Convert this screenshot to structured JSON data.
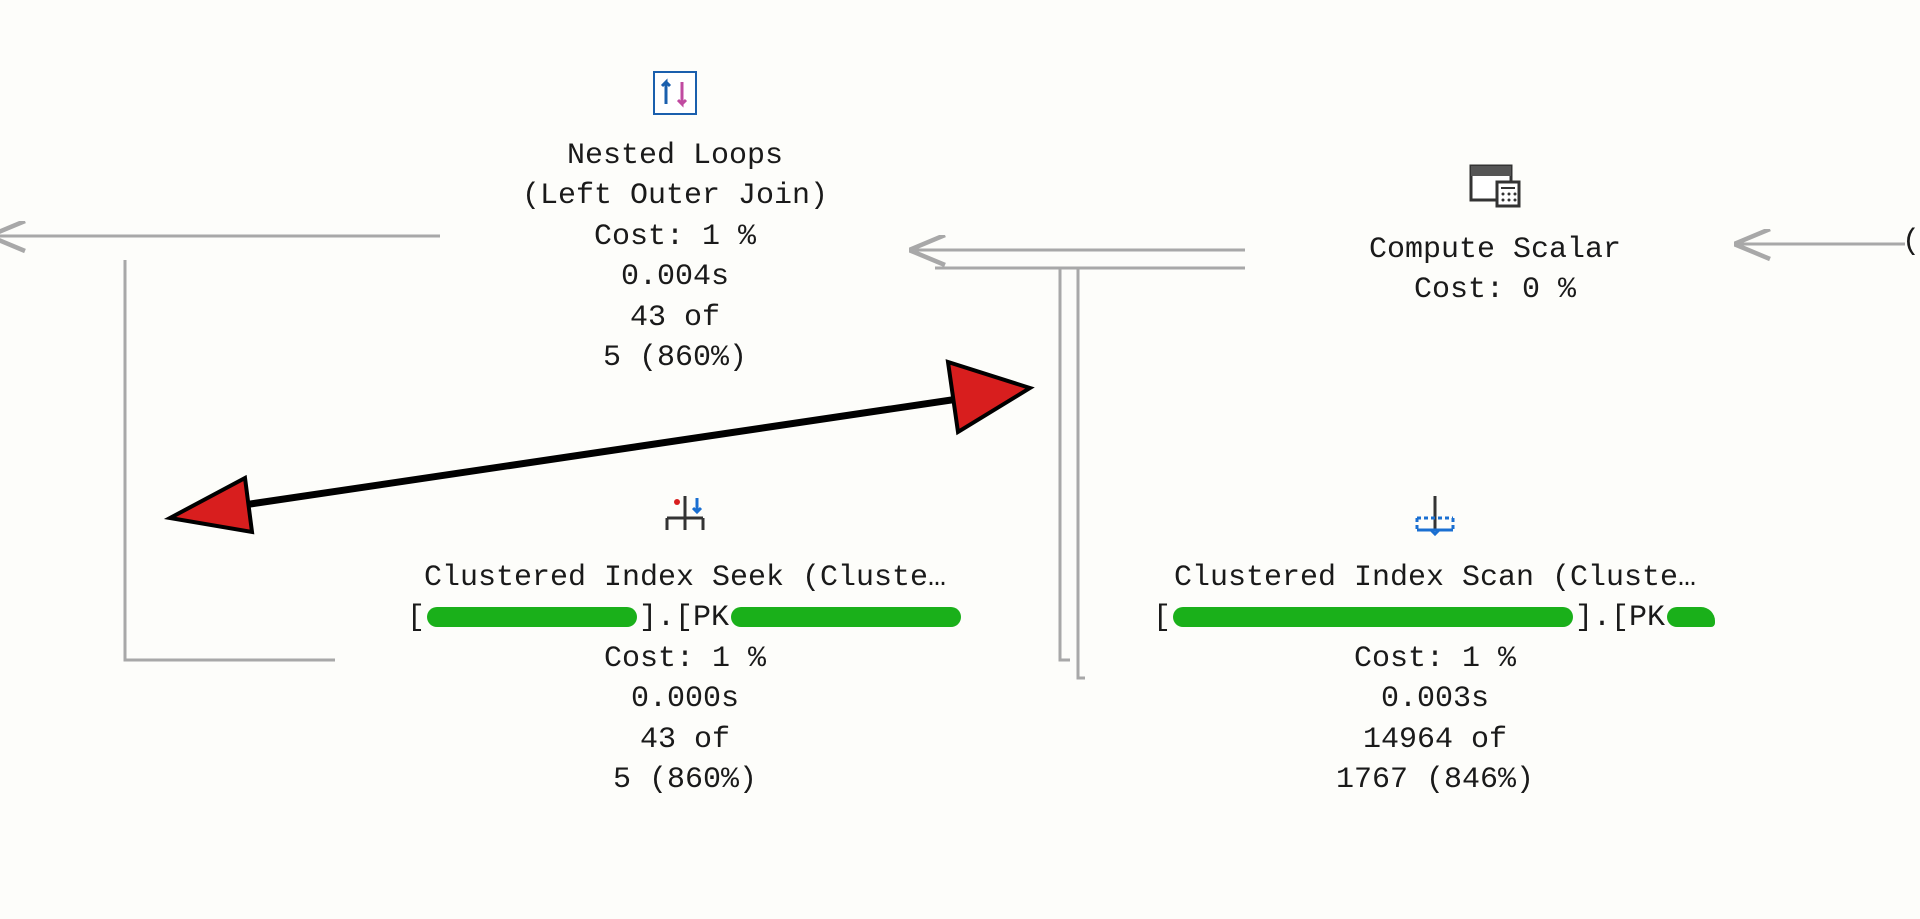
{
  "nodes": {
    "nested_loops": {
      "title": "Nested Loops",
      "subtitle": "(Left Outer Join)",
      "cost": "Cost: 1 %",
      "time": "0.004s",
      "rows_actual": "43 of",
      "rows_est": "5 (860%)"
    },
    "compute_scalar": {
      "title": "Compute Scalar",
      "cost": "Cost: 0 %"
    },
    "index_seek": {
      "title": "Clustered Index Seek (Cluste…",
      "obj_prefix": "[",
      "obj_mid": "].[PK",
      "cost": "Cost: 1 %",
      "time": "0.000s",
      "rows_actual": "43 of",
      "rows_est": "5 (860%)"
    },
    "index_scan": {
      "title": "Clustered Index Scan (Cluste…",
      "obj_prefix": "[",
      "obj_mid": "].[PK",
      "cost": "Cost: 1 %",
      "time": "0.003s",
      "rows_actual": "14964 of",
      "rows_est": "1767 (846%)"
    }
  },
  "fragments": {
    "right_paren": "("
  }
}
